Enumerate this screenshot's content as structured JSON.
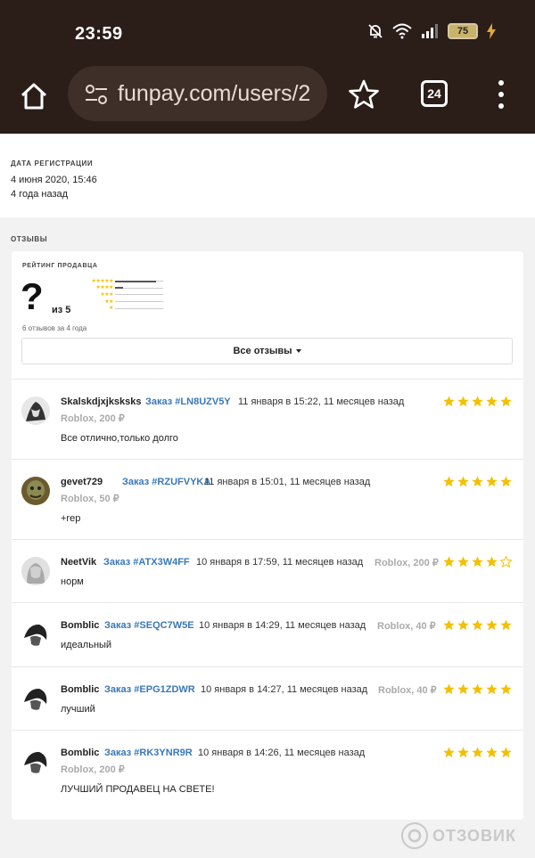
{
  "status_bar": {
    "time": "23:59",
    "battery": "75",
    "icons": [
      "mute-bell-icon",
      "wifi-icon",
      "signal-icon",
      "battery-icon",
      "charging-icon"
    ]
  },
  "browser": {
    "url": "funpay.com/users/2",
    "tab_count": "24",
    "icons": [
      "home-icon",
      "site-settings-icon",
      "bookmark-star-icon",
      "tabs-icon",
      "more-menu-icon"
    ]
  },
  "registration": {
    "label": "ДАТА РЕГИСТРАЦИИ",
    "date": "4 июня 2020, 15:46",
    "ago": "4 года назад"
  },
  "reviews": {
    "section_label": "ОТЗЫВЫ",
    "rating_label": "РЕЙТИНГ ПРОДАВЦА",
    "rating_value": "?",
    "rating_of": "из 5",
    "distribution": [
      {
        "stars": 5,
        "fraction": 0.85
      },
      {
        "stars": 4,
        "fraction": 0.17
      },
      {
        "stars": 3,
        "fraction": 0
      },
      {
        "stars": 2,
        "fraction": 0
      },
      {
        "stars": 1,
        "fraction": 0
      }
    ],
    "count_text": "6 отзывов за 4 года",
    "all_reviews_button": "Все отзывы",
    "items": [
      {
        "user": "Skalskdjxjksksks",
        "order": "Заказ #LN8UZV5Y",
        "date": "11 января в 15:22, 11 месяцев назад",
        "game": "Roblox, 200 ₽",
        "text": "Все отлично,только долго",
        "rating": 5
      },
      {
        "user": "gevet729",
        "order": "Заказ #RZUFVYKA",
        "date": "11 января в 15:01, 11 месяцев назад",
        "game": "Roblox, 50 ₽",
        "text": "+rep",
        "rating": 5
      },
      {
        "user": "NeetVik",
        "order": "Заказ #ATX3W4FF",
        "date": "10 января в 17:59, 11 месяцев назад",
        "game": "Roblox, 200 ₽",
        "text": "норм",
        "rating": 4
      },
      {
        "user": "Bomblic",
        "order": "Заказ #SEQC7W5E",
        "date": "10 января в 14:29, 11 месяцев назад",
        "game": "Roblox, 40 ₽",
        "text": "идеальный",
        "rating": 5
      },
      {
        "user": "Bomblic",
        "order": "Заказ #EPG1ZDWR",
        "date": "10 января в 14:27, 11 месяцев назад",
        "game": "Roblox, 40 ₽",
        "text": "лучший",
        "rating": 5
      },
      {
        "user": "Bomblic",
        "order": "Заказ #RK3YNR9R",
        "date": "10 января в 14:26, 11 месяцев назад",
        "game": "Roblox, 200 ₽",
        "text": "ЛУЧШИЙ ПРОДАВЕЦ НА СВЕТЕ!",
        "rating": 5
      }
    ]
  },
  "watermark": {
    "text": "ОТЗОВИК"
  },
  "colors": {
    "chrome_bg": "#2b1d18",
    "link": "#3a78b6",
    "star": "#f3c000"
  }
}
